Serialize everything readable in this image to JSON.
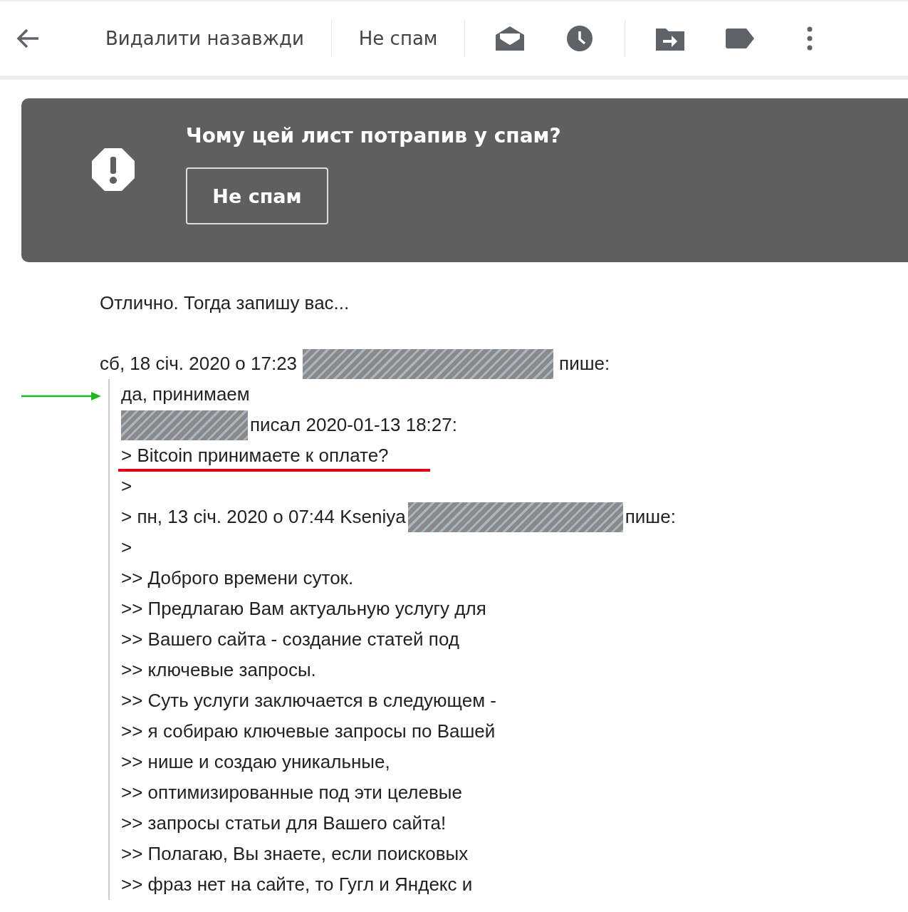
{
  "toolbar": {
    "buttons": [
      {
        "kind": "back"
      },
      {
        "kind": "text",
        "label": "Видалити назавжди"
      },
      {
        "kind": "text",
        "label": "Не спам"
      },
      {
        "kind": "mark-read"
      },
      {
        "kind": "snooze"
      },
      {
        "kind": "move"
      },
      {
        "kind": "label"
      },
      {
        "kind": "more"
      }
    ]
  },
  "spam_banner": {
    "title": "Чому цей лист потрапив у спам?",
    "button": "Не спам"
  },
  "message": {
    "reply": "Отлично. Тогда запишу вас...",
    "attribution": {
      "prefix": "сб, 18 січ. 2020 о 17:23",
      "suffix": "пише:",
      "redacted": true
    },
    "quote": [
      {
        "kind": "text",
        "text": "да, принимаем",
        "arrow": true
      },
      {
        "kind": "attribution",
        "suffix": "писал 2020-01-13 18:27:",
        "redacted": true
      },
      {
        "kind": "text",
        "text": "> Bitcoin принимаете к оплате?",
        "underlined": true
      },
      {
        "kind": "text",
        "text": ">"
      },
      {
        "kind": "attribution",
        "prefix": "> пн, 13 січ. 2020 о 07:44 Kseniya",
        "suffix": "пише:",
        "redacted": true
      },
      {
        "kind": "text",
        "text": ">"
      },
      {
        "kind": "text",
        "text": ">> Доброго времени суток."
      },
      {
        "kind": "text",
        "text": ">> Предлагаю Вам актуальную услугу для"
      },
      {
        "kind": "text",
        "text": ">> Вашего сайта - создание статей под"
      },
      {
        "kind": "text",
        "text": ">> ключевые запросы."
      },
      {
        "kind": "text",
        "text": ">> Суть услуги заключается в следующем -"
      },
      {
        "kind": "text",
        "text": ">> я собираю ключевые запросы по Вашей"
      },
      {
        "kind": "text",
        "text": ">> нише и создаю уникальные,"
      },
      {
        "kind": "text",
        "text": ">> оптимизированные под эти целевые"
      },
      {
        "kind": "text",
        "text": ">> запросы статьи для Вашего сайта!"
      },
      {
        "kind": "text",
        "text": ">> Полагаю, Вы знаете, если поисковых"
      },
      {
        "kind": "text",
        "text": ">> фраз нет на сайте, то Гугл и Яндекс и"
      }
    ]
  }
}
